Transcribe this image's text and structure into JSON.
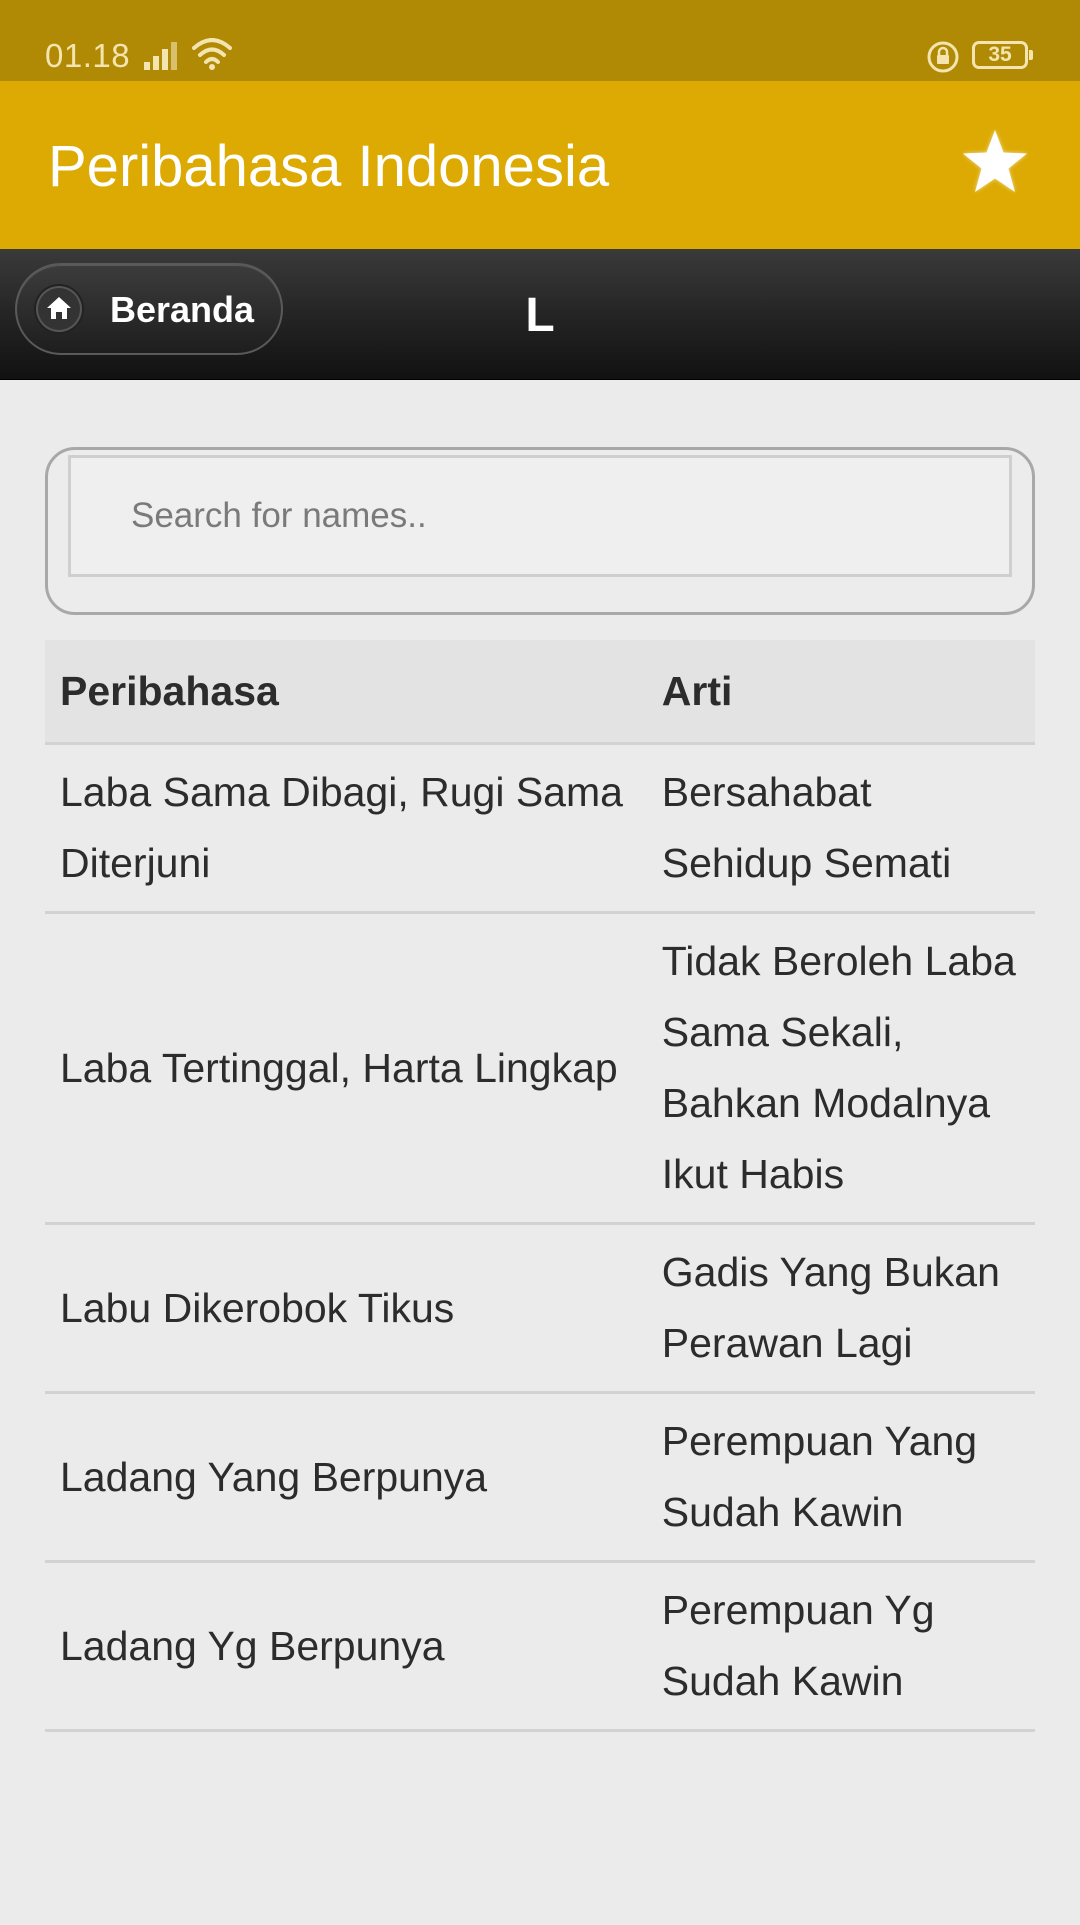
{
  "status_bar": {
    "time": "01.18",
    "battery": "35",
    "icons": [
      "signal-icon",
      "wifi-icon",
      "rotation-lock-icon",
      "battery-icon"
    ]
  },
  "app_bar": {
    "title": "Peribahasa Indonesia",
    "action_icon": "star-icon"
  },
  "nav_bar": {
    "home_label": "Beranda",
    "home_icon": "home-icon",
    "title": "L"
  },
  "search": {
    "placeholder": "Search for names..",
    "value": ""
  },
  "table": {
    "headers": [
      "Peribahasa",
      "Arti"
    ],
    "rows": [
      {
        "peribahasa": "Laba Sama Dibagi, Rugi Sama Diterjuni",
        "arti": "Bersahabat Sehidup Semati"
      },
      {
        "peribahasa": "Laba Tertinggal, Harta Lingkap",
        "arti": "Tidak Beroleh Laba Sama Sekali, Bahkan Modalnya Ikut Habis"
      },
      {
        "peribahasa": "Labu Dikerobok Tikus",
        "arti": "Gadis Yang Bukan Perawan Lagi"
      },
      {
        "peribahasa": "Ladang Yang Berpunya",
        "arti": "Perempuan Yang Sudah Kawin"
      },
      {
        "peribahasa": "Ladang Yg Berpunya",
        "arti": "Perempuan Yg Sudah Kawin"
      }
    ]
  },
  "colors": {
    "status_bar": "#b18a05",
    "app_bar": "#dcaa03",
    "nav_bar": "#1e1e1e",
    "background": "#ebebeb",
    "text": "#2c2c2c"
  }
}
